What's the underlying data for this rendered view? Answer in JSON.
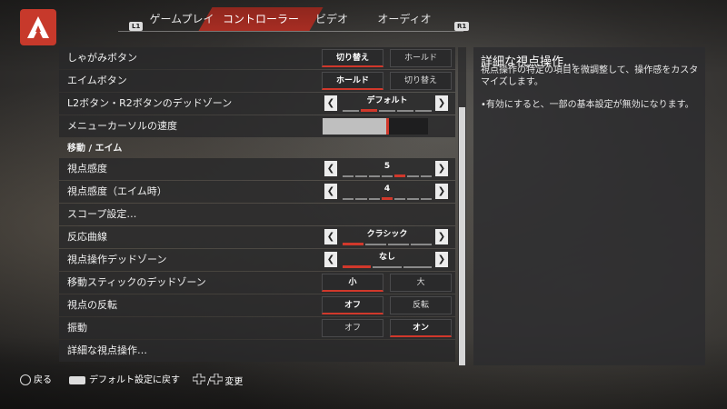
{
  "tabs": [
    {
      "label": "ゲームプレイ"
    },
    {
      "label": "コントローラー"
    },
    {
      "label": "ビデオ"
    },
    {
      "label": "オーディオ"
    }
  ],
  "tab_hints": {
    "left": "L1",
    "right": "R1"
  },
  "rows": {
    "crouch": {
      "label": "しゃがみボタン",
      "options": [
        "切り替え",
        "ホールド"
      ],
      "selected": 0
    },
    "aim": {
      "label": "エイムボタン",
      "options": [
        "ホールド",
        "切り替え"
      ],
      "selected": 0
    },
    "deadzone_l2r2": {
      "label": "L2ボタン・R2ボタンのデッドゾーン",
      "value": "デフォルト"
    },
    "cursor_speed": {
      "label": "メニューカーソルの速度",
      "level": 0.6
    },
    "section_move_aim": {
      "label": "移動 / エイム"
    },
    "look_sens": {
      "label": "視点感度",
      "value": "5"
    },
    "look_sens_ads": {
      "label": "視点感度（エイム時）",
      "value": "4"
    },
    "scope": {
      "label": "スコープ設定…"
    },
    "response_curve": {
      "label": "反応曲線",
      "value": "クラシック"
    },
    "look_deadzone": {
      "label": "視点操作デッドゾーン",
      "value": "なし"
    },
    "move_deadzone": {
      "label": "移動スティックのデッドゾーン",
      "options": [
        "小",
        "大"
      ],
      "selected": 0
    },
    "invert_look": {
      "label": "視点の反転",
      "options": [
        "オフ",
        "反転"
      ],
      "selected": 0
    },
    "vibration": {
      "label": "振動",
      "options": [
        "オフ",
        "オン"
      ],
      "selected": 1
    },
    "advanced_look": {
      "label": "詳細な視点操作…"
    }
  },
  "info": {
    "title": "詳細な視点操作…",
    "description": "視点操作の特定の項目を微調整して、操作感をカスタマイズします。",
    "note": "•有効にすると、一部の基本設定が無効になります。"
  },
  "footer": {
    "back": "戻る",
    "reset": "デフォルト設定に戻す",
    "change_sep": "/",
    "change": "変更"
  },
  "colors": {
    "accent": "#d1382b",
    "logo": "#c7392b"
  },
  "icons": {
    "logo": "apex-logo-icon",
    "left": "left-arrow-icon",
    "right": "right-arrow-icon"
  }
}
